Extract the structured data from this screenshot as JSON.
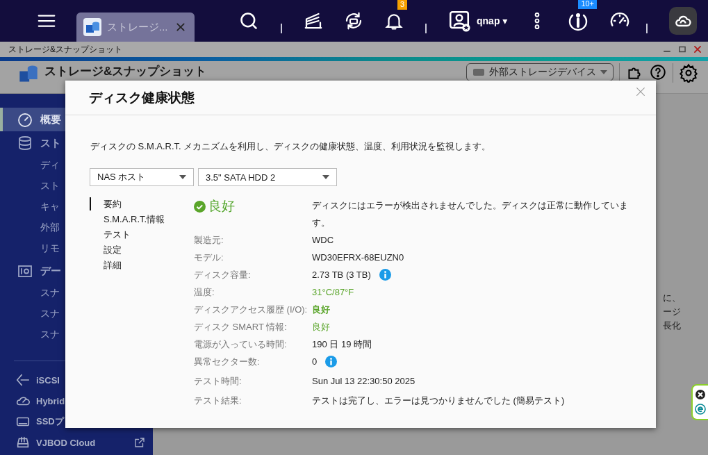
{
  "topbar": {
    "tab": {
      "label": "ストレージ..."
    },
    "notification_badge": "3",
    "user": "qnap",
    "user_caret": "▾",
    "info_badge": "10+"
  },
  "window": {
    "title": "ストレージ&スナップショット"
  },
  "app_header": {
    "title": "ストレージ&スナップショット",
    "device_select": "外部ストレージデバイス"
  },
  "sidebar": {
    "items": [
      {
        "label": "概要",
        "kind": "section",
        "selected": true
      },
      {
        "label": "スト",
        "kind": "section",
        "selected": false
      },
      {
        "label": "ディ",
        "kind": "sub"
      },
      {
        "label": "スト",
        "kind": "sub"
      },
      {
        "label": "キャ",
        "kind": "sub"
      },
      {
        "label": "外部",
        "kind": "sub"
      },
      {
        "label": "リモ",
        "kind": "sub"
      },
      {
        "label": "デー",
        "kind": "section",
        "selected": false
      },
      {
        "label": "スナ",
        "kind": "sub"
      },
      {
        "label": "スナ",
        "kind": "sub"
      },
      {
        "label": "スナ",
        "kind": "sub"
      }
    ],
    "bottom_items": [
      {
        "label": "iSCSI"
      },
      {
        "label": "Hybrid"
      },
      {
        "label": "SSDプ"
      },
      {
        "label": "VJBOD Cloud"
      }
    ]
  },
  "background_text": [
    "に、",
    "ージ",
    "長化"
  ],
  "dialog": {
    "title": "ディスク健康状態",
    "description": "ディスクの S.M.A.R.T. メカニズムを利用し、ディスクの健康状態、温度、利用状況を監視します。",
    "selects": [
      {
        "value": "NAS ホスト"
      },
      {
        "value": "3.5\" SATA HDD 2"
      }
    ],
    "nav": [
      {
        "label": "要約",
        "selected": true
      },
      {
        "label": "S.M.A.R.T.情報",
        "selected": false
      },
      {
        "label": "テスト",
        "selected": false
      },
      {
        "label": "設定",
        "selected": false
      },
      {
        "label": "詳細",
        "selected": false
      }
    ],
    "status": {
      "label": "良好",
      "message": "ディスクにはエラーが検出されませんでした。ディスクは正常に動作しています。"
    },
    "details": [
      {
        "label": "製造元:",
        "value": "WDC",
        "good": false,
        "bold": false,
        "info": false
      },
      {
        "label": "モデル:",
        "value": "WD30EFRX-68EUZN0",
        "good": false,
        "bold": false,
        "info": false
      },
      {
        "label": "ディスク容量:",
        "value": "2.73 TB (3 TB)",
        "good": false,
        "bold": false,
        "info": true
      },
      {
        "label": "温度:",
        "value": "31°C/87°F",
        "good": true,
        "bold": false,
        "info": false
      },
      {
        "label": "ディスクアクセス履歴 (I/O):",
        "value": "良好",
        "good": true,
        "bold": true,
        "info": false
      },
      {
        "label": "ディスク SMART 情報:",
        "value": "良好",
        "good": true,
        "bold": false,
        "info": false
      },
      {
        "label": "電源が入っている時間:",
        "value": "190 日 19 時間",
        "good": false,
        "bold": false,
        "info": false
      },
      {
        "label": "異常セクター数:",
        "value": "0",
        "good": false,
        "bold": false,
        "info": true
      },
      {
        "label": "テスト時間:",
        "value": "Sun Jul 13 22:30:50 2025",
        "good": false,
        "bold": false,
        "info": false
      },
      {
        "label": "テスト結果:",
        "value": "テストは完了し、エラーは見つかりませんでした (簡易テスト)",
        "good": false,
        "bold": false,
        "info": false
      }
    ]
  }
}
